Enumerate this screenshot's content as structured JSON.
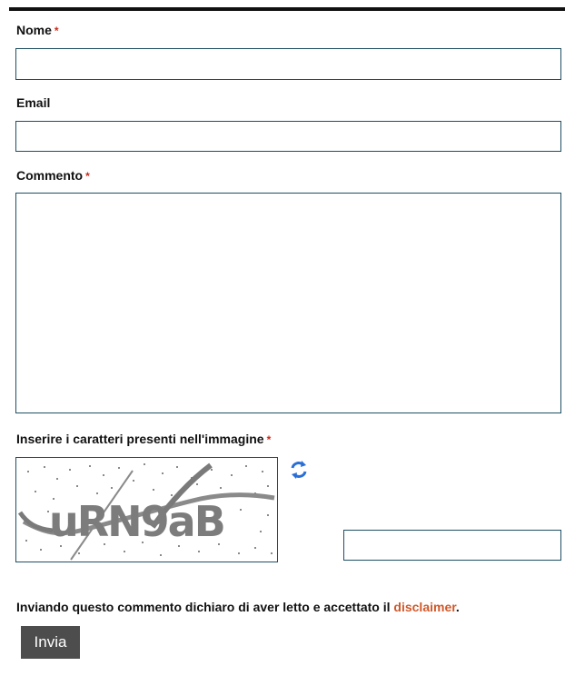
{
  "form": {
    "name_label": "Nome",
    "email_label": "Email",
    "comment_label": "Commento",
    "required_marker": "*",
    "name_value": "",
    "email_value": "",
    "comment_value": ""
  },
  "captcha": {
    "label": "Inserire i caratteri presenti nell'immagine",
    "image_text": "uRN9aB",
    "refresh_icon": "refresh-arrows-icon",
    "input_value": ""
  },
  "disclaimer": {
    "prefix": "Inviando questo commento dichiaro di aver letto e accettato il",
    "link_label": "disclaimer",
    "suffix": "."
  },
  "submit": {
    "label": "Invia"
  },
  "colors": {
    "required": "#cc2a1a",
    "link": "#d0582a",
    "field_border": "#1d4f63",
    "button_bg": "#4d4d4d",
    "refresh_icon": "#2a6fd6"
  }
}
